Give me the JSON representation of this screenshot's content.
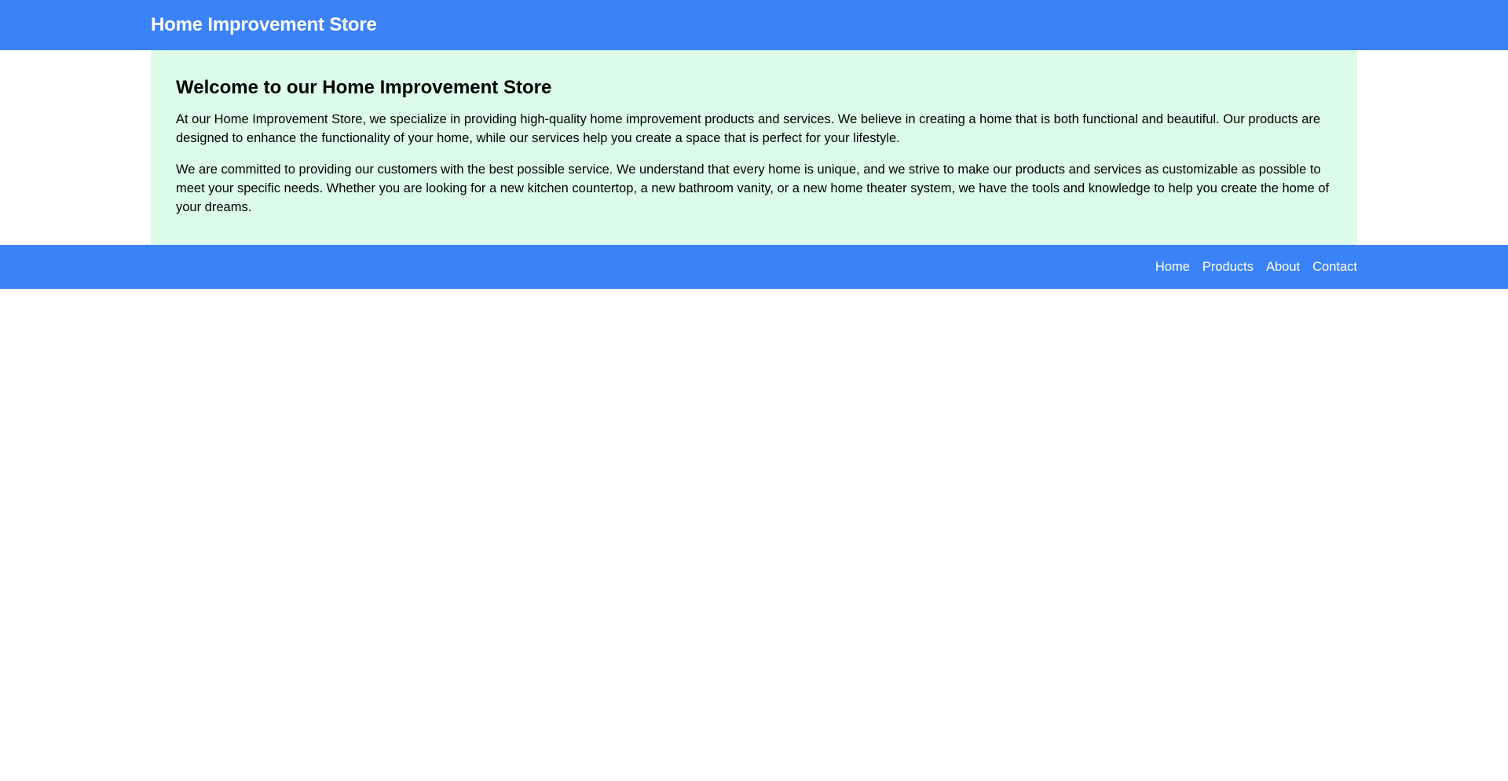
{
  "header": {
    "title": "Home Improvement Store"
  },
  "main": {
    "heading": "Welcome to our Home Improvement Store",
    "paragraphs": [
      "At our Home Improvement Store, we specialize in providing high-quality home improvement products and services. We believe in creating a home that is both functional and beautiful. Our products are designed to enhance the functionality of your home, while our services help you create a space that is perfect for your lifestyle.",
      "We are committed to providing our customers with the best possible service. We understand that every home is unique, and we strive to make our products and services as customizable as possible to meet your specific needs. Whether you are looking for a new kitchen countertop, a new bathroom vanity, or a new home theater system, we have the tools and knowledge to help you create the home of your dreams."
    ]
  },
  "footer": {
    "nav": [
      {
        "label": "Home"
      },
      {
        "label": "Products"
      },
      {
        "label": "About"
      },
      {
        "label": "Contact"
      }
    ]
  },
  "colors": {
    "brand_blue": "#3b82f6",
    "panel_green": "#dcfce7",
    "text": "#000000",
    "header_text": "#ffffff"
  }
}
